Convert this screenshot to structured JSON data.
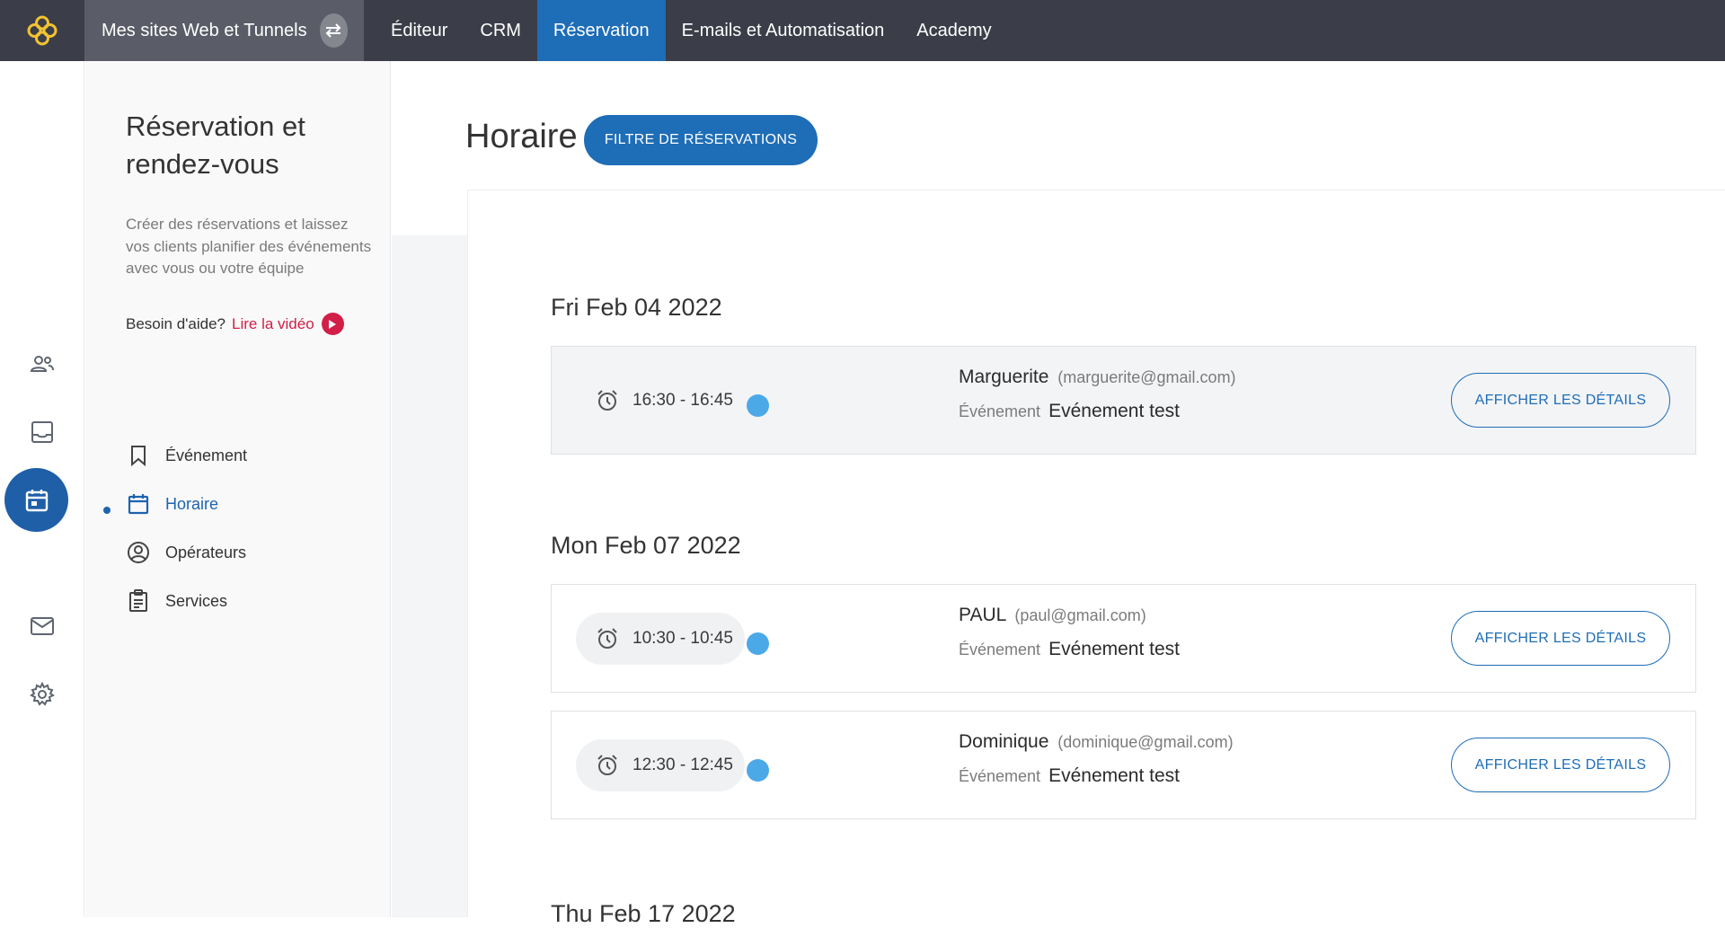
{
  "topnav": {
    "logo": "app-logo",
    "sites_label": "Mes sites Web et Tunnels",
    "items": [
      {
        "label": "Éditeur"
      },
      {
        "label": "CRM"
      },
      {
        "label": "Réservation"
      },
      {
        "label": "E-mails et Automatisation"
      },
      {
        "label": "Academy"
      }
    ],
    "active": "Réservation",
    "accent_color": "#1e6db7"
  },
  "rail": {
    "icons": [
      "contacts-icon",
      "inbox-icon",
      "calendar-icon",
      "mail-icon",
      "settings-icon"
    ],
    "active": "calendar-icon"
  },
  "panel": {
    "title": "Réservation et rendez-vous",
    "description": "Créer des réservations et laissez vos clients planifier des événements avec vous ou votre équipe",
    "help_text": "Besoin d'aide?",
    "help_link": "Lire la vidéo",
    "menu": [
      {
        "label": "Événement",
        "icon": "bookmark-icon"
      },
      {
        "label": "Horaire",
        "icon": "calendar-icon",
        "active": true
      },
      {
        "label": "Opérateurs",
        "icon": "account-circle-icon"
      },
      {
        "label": "Services",
        "icon": "clipboard-icon"
      }
    ]
  },
  "main": {
    "title": "Horaire",
    "filter_button": "FILTRE DE RÉSERVATIONS",
    "days": [
      {
        "date": "Fri Feb 04 2022",
        "bookings": [
          {
            "time": "16:30 - 16:45",
            "name": "Marguerite",
            "email": "(marguerite@gmail.com)",
            "event_label": "Événement",
            "event_name": "Evénement test",
            "button": "AFFICHER LES DÉTAILS"
          }
        ]
      },
      {
        "date": "Mon Feb 07 2022",
        "bookings": [
          {
            "time": "10:30 - 10:45",
            "name": "PAUL",
            "email": "(paul@gmail.com)",
            "event_label": "Événement",
            "event_name": "Evénement test",
            "button": "AFFICHER LES DÉTAILS"
          },
          {
            "time": "12:30 - 12:45",
            "name": "Dominique",
            "email": "(dominique@gmail.com)",
            "event_label": "Événement",
            "event_name": "Evénement test",
            "button": "AFFICHER LES DÉTAILS"
          }
        ]
      },
      {
        "date": "Thu Feb 17 2022",
        "bookings": []
      }
    ],
    "status_dot_color": "#4ba9e8"
  }
}
